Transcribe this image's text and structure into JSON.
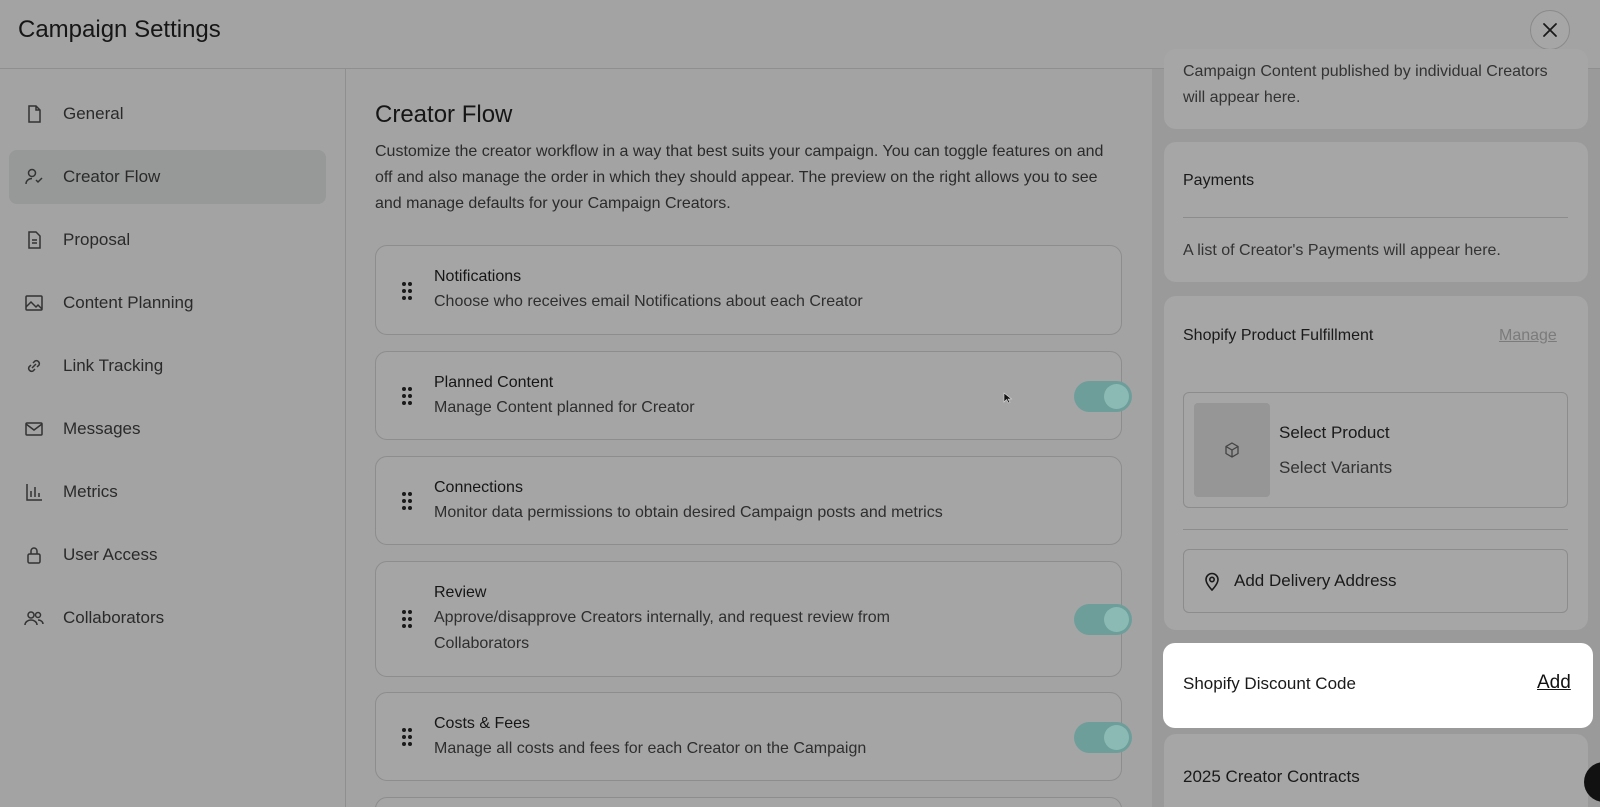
{
  "header": {
    "title": "Campaign Settings",
    "close_icon": "close-icon"
  },
  "sidebar": {
    "items": [
      {
        "label": "General",
        "icon": "document-icon"
      },
      {
        "label": "Creator Flow",
        "icon": "user-check-icon",
        "active": true
      },
      {
        "label": "Proposal",
        "icon": "document-text-icon"
      },
      {
        "label": "Content Planning",
        "icon": "image-icon"
      },
      {
        "label": "Link Tracking",
        "icon": "link-icon"
      },
      {
        "label": "Messages",
        "icon": "mail-icon"
      },
      {
        "label": "Metrics",
        "icon": "bar-chart-icon"
      },
      {
        "label": "User Access",
        "icon": "lock-icon"
      },
      {
        "label": "Collaborators",
        "icon": "users-icon"
      }
    ]
  },
  "main": {
    "title": "Creator Flow",
    "description": "Customize the creator workflow in a way that best suits your campaign. You can toggle features on and off and also manage the order in which they should appear. The preview on the right allows you to see and manage defaults for your Campaign Creators.",
    "cards": [
      {
        "title": "Notifications",
        "desc": "Choose who receives email Notifications about each Creator",
        "toggle": false
      },
      {
        "title": "Planned Content",
        "desc": "Manage Content planned for Creator",
        "toggle": true
      },
      {
        "title": "Connections",
        "desc": "Monitor data permissions to obtain desired Campaign posts and metrics",
        "toggle": false
      },
      {
        "title": "Review",
        "desc": "Approve/disapprove Creators internally, and request review from Collaborators",
        "toggle": true
      },
      {
        "title": "Costs & Fees",
        "desc": "Manage all costs and fees for each Creator on the Campaign",
        "toggle": true
      }
    ]
  },
  "preview": {
    "content_note": "Campaign Content published by individual Creators will appear here.",
    "payments": {
      "title": "Payments",
      "note": "A list of Creator's Payments will appear here."
    },
    "shopify_fulfillment": {
      "title": "Shopify Product Fulfillment",
      "manage_label": "Manage",
      "select_product": "Select Product",
      "select_variants": "Select Variants",
      "add_delivery": "Add Delivery Address"
    },
    "discount": {
      "title": "Shopify Discount Code",
      "add_label": "Add"
    },
    "contracts": {
      "title": "2025 Creator Contracts"
    }
  },
  "colors": {
    "overlay": "#a3a3a3",
    "toggle_on": "#6e9e9a",
    "highlight": "#ffffff"
  }
}
